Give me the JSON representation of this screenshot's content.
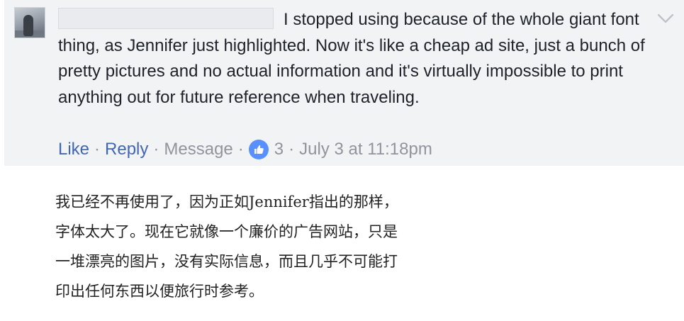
{
  "comment": {
    "author_redacted": true,
    "text": "I stopped using because of the whole giant font thing, as Jennifer just highlighted. Now it's like a cheap ad site, just a bunch of pretty pictures and no actual information and it's virtually impossible to print anything out for future reference when traveling.",
    "actions": {
      "like": "Like",
      "reply": "Reply",
      "message": "Message",
      "separator": "·",
      "reaction_count": "3",
      "timestamp": "July 3 at 11:18pm"
    },
    "menu_icon": "chevron-down-icon",
    "reaction_icon": "thumbs-up-icon"
  },
  "translation": {
    "lines": [
      "我已经不再使用了，因为正如Jennifer指出的那样，",
      "字体太大了。现在它就像一个廉价的广告网站，只是",
      "一堆漂亮的图片，没有实际信息，而且几乎不可能打",
      "印出任何东西以便旅行时参考。"
    ]
  },
  "colors": {
    "comment_bg": "#f2f3f5",
    "link": "#4267b2",
    "meta": "#90949c",
    "like_badge": "#5890ff",
    "text": "#1d2129"
  }
}
